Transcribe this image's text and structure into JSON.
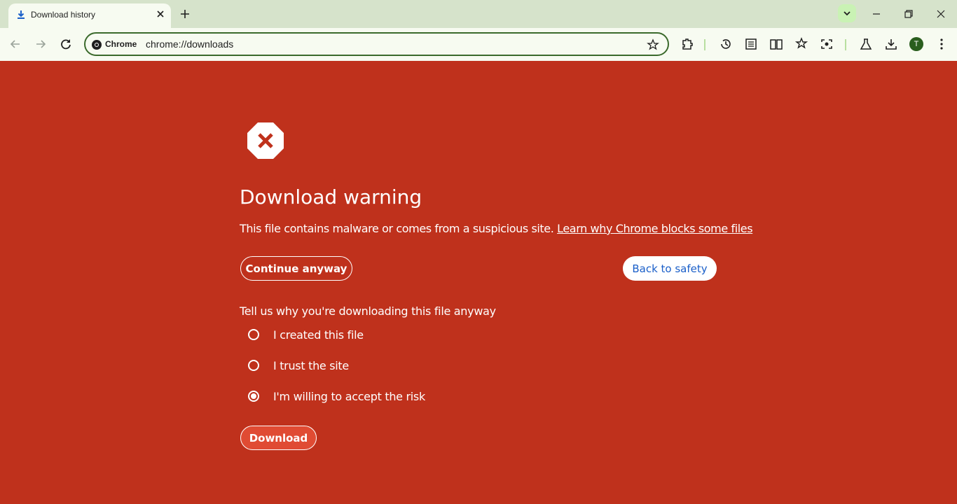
{
  "browser": {
    "tab": {
      "title": "Download history",
      "icon": "download-icon"
    },
    "omnibox": {
      "chip_label": "Chrome",
      "url": "chrome://downloads"
    },
    "avatar_initial": "T",
    "accent_color": "#3b6a2c"
  },
  "page": {
    "title": "Download warning",
    "description": "This file contains malware or comes from a suspicious site.",
    "learn_more_link": "Learn why Chrome blocks some files",
    "continue_label": "Continue anyway",
    "back_label": "Back to safety",
    "reason_prompt": "Tell us why you're downloading this file anyway",
    "reasons": [
      {
        "label": "I created this file",
        "checked": false
      },
      {
        "label": "I trust the site",
        "checked": false
      },
      {
        "label": "I'm willing to accept the risk",
        "checked": true
      }
    ],
    "download_label": "Download",
    "background_color": "#bf311c"
  }
}
